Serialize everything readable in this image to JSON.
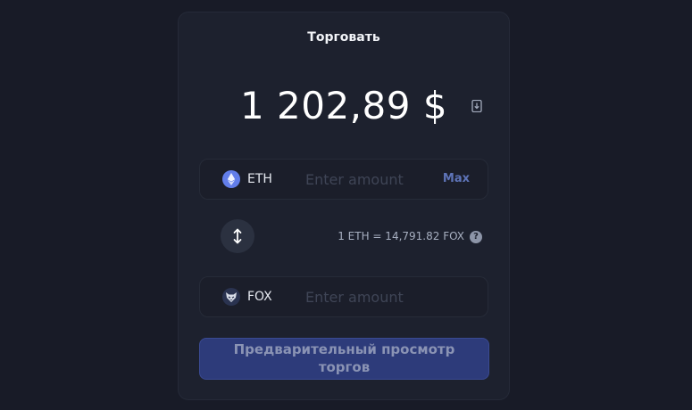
{
  "title": "Торговать",
  "fiat_amount": "1 202,89 $",
  "sell": {
    "symbol": "ETH",
    "placeholder": "Enter amount",
    "max_label": "Max",
    "icon": "eth-icon",
    "icon_color": "#627eea"
  },
  "rate_text": "1 ETH = 14,791.82 FOX",
  "help_glyph": "?",
  "buy": {
    "symbol": "FOX",
    "placeholder": "Enter amount",
    "icon": "fox-icon"
  },
  "preview_button": {
    "line1": "Предварительный просмотр",
    "line2": "торгов"
  },
  "colors": {
    "background": "#181b27",
    "card": "#1d212e",
    "accent": "#2d3b7a",
    "max": "#5e74b8"
  }
}
